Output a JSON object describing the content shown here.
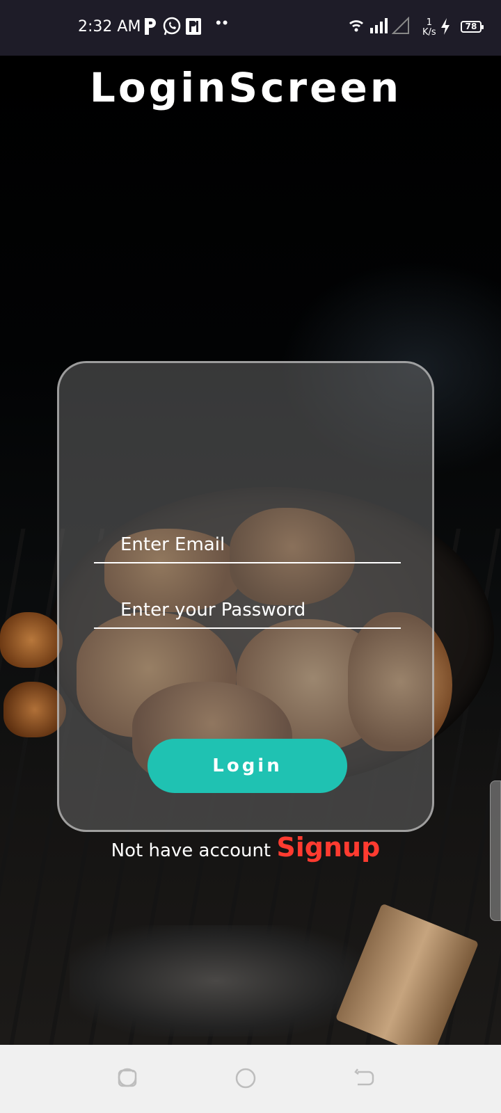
{
  "status_bar": {
    "time": "2:32 AM",
    "dots": "••",
    "net_speed_value": "1",
    "net_speed_unit": "K/s",
    "battery": "78"
  },
  "title": "LoginScreen",
  "form": {
    "email_placeholder": "Enter Email",
    "password_placeholder": "Enter your Password",
    "login_label": "Login"
  },
  "footer": {
    "prompt": "Not have account",
    "signup_label": "Signup"
  },
  "colors": {
    "accent": "#1fc2b2",
    "signup": "#ff3b30",
    "status_bar_bg": "#1e1c28",
    "nav_bar_bg": "#f0f0f0"
  },
  "icons": {
    "status_bar": [
      "paytm-icon",
      "whatsapp-icon",
      "parking-icon",
      "wifi-icon",
      "signal-icon",
      "signal-empty-icon",
      "charging-icon",
      "battery-icon"
    ],
    "nav_bar": [
      "recent-apps-icon",
      "home-icon",
      "back-icon"
    ]
  }
}
